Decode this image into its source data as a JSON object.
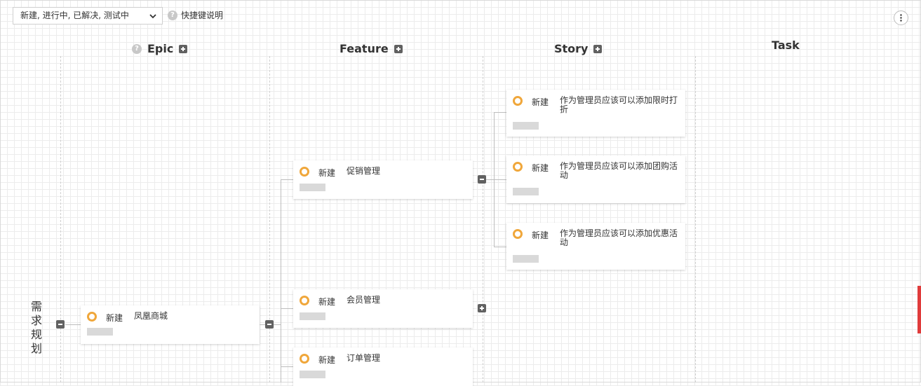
{
  "toolbar": {
    "filter_value": "新建, 进行中, 已解决, 测试中",
    "shortcut_label": "快捷键说明"
  },
  "columns": {
    "epic": "Epic",
    "feature": "Feature",
    "story": "Story",
    "task": "Task"
  },
  "row_label": "需求规划",
  "epic": {
    "status": "新建",
    "title": "凤凰商城"
  },
  "features": [
    {
      "status": "新建",
      "title": "促销管理"
    },
    {
      "status": "新建",
      "title": "会员管理"
    },
    {
      "status": "新建",
      "title": "订单管理"
    }
  ],
  "stories": [
    {
      "status": "新建",
      "title": "作为管理员应该可以添加限时打折"
    },
    {
      "status": "新建",
      "title": "作为管理员应该可以添加团购活动"
    },
    {
      "status": "新建",
      "title": "作为管理员应该可以添加优惠活动"
    }
  ],
  "colors": {
    "status_ring": "#f0a73b",
    "control": "#616161",
    "accent_tab": "#e03b3b"
  }
}
